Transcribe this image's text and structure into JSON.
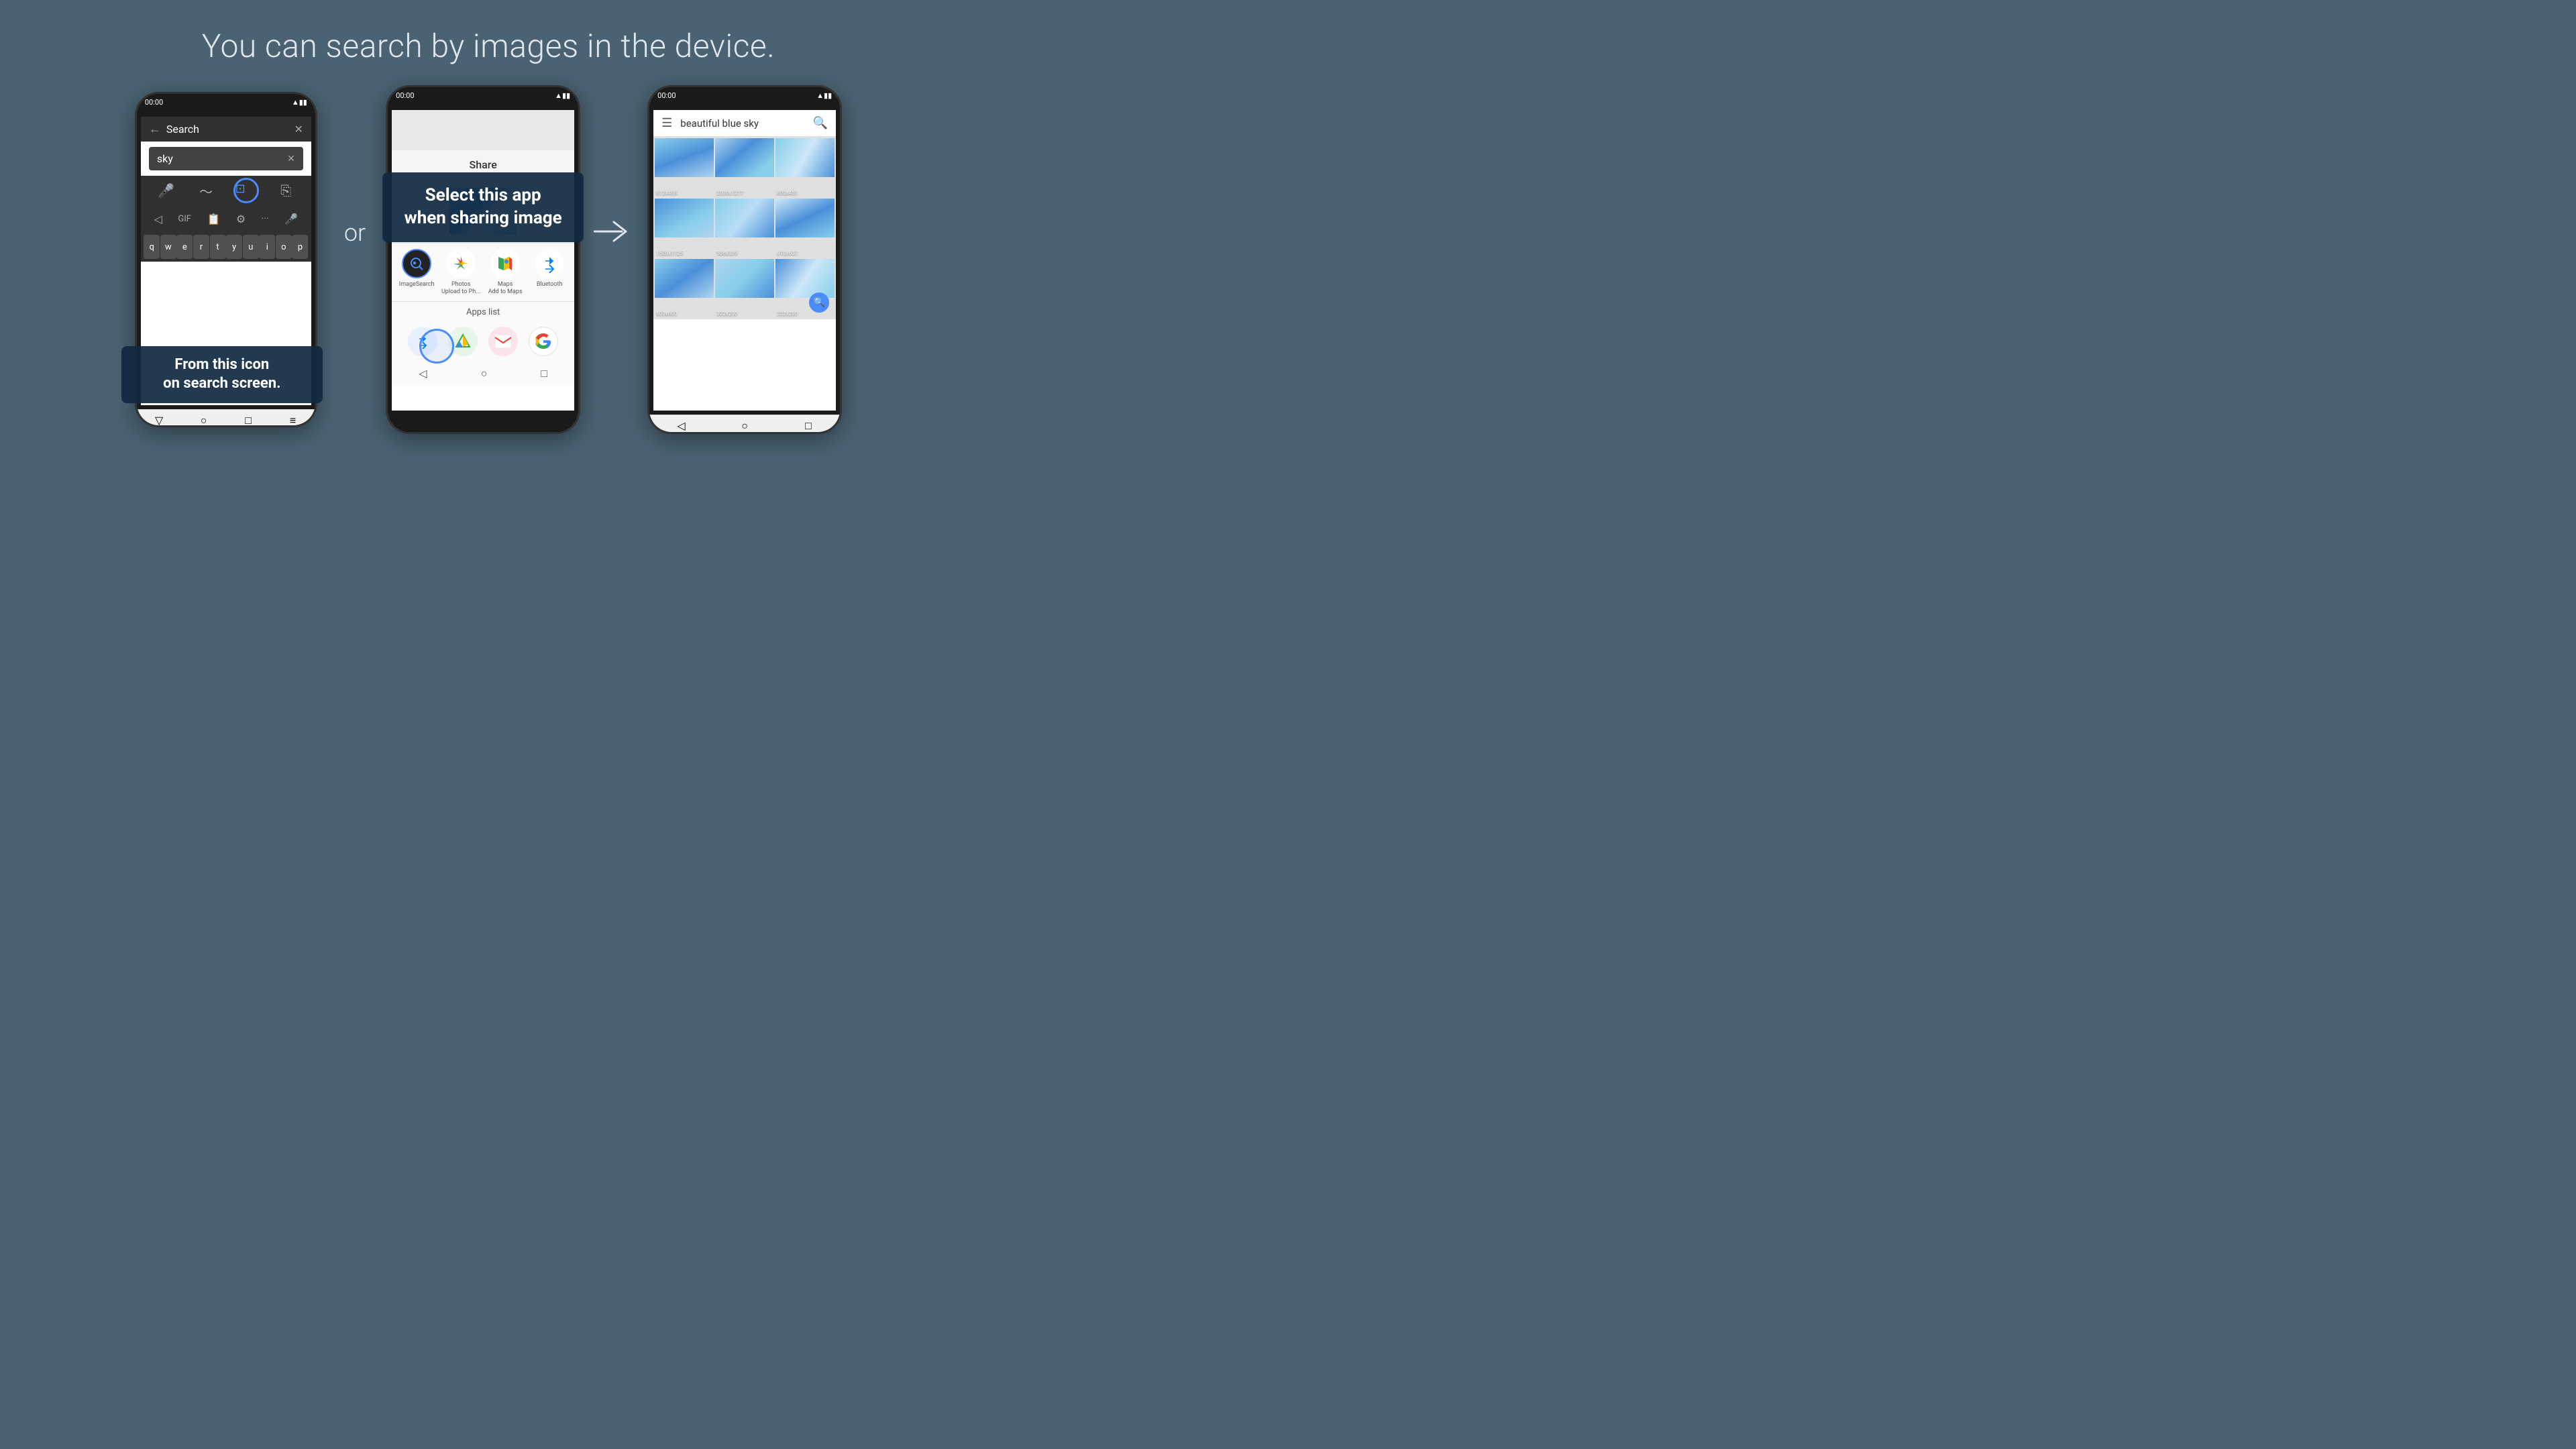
{
  "page": {
    "title": "You can search by images in the device.",
    "background_color": "#4a6272"
  },
  "connector_text": "or",
  "arrow_symbol": "⇒",
  "phone1": {
    "status_time": "00:00",
    "search_placeholder": "Search",
    "search_query": "sky",
    "callout_line1": "From this icon",
    "callout_line2": "on search screen.",
    "keyboard_keys": [
      "q",
      "w",
      "e",
      "r",
      "t",
      "y",
      "u",
      "i",
      "o",
      "p"
    ]
  },
  "phone2": {
    "status_time": "00:00",
    "share_header": "Share",
    "callout_line1": "Select this app",
    "callout_line2": "when sharing image",
    "app1_label": "ImageSearch",
    "app2_label": "Photos\nUpload to Ph...",
    "app3_label": "Maps\nAdd to Maps",
    "app4_label": "Bluetooth",
    "apps_list_label": "Apps list"
  },
  "phone3": {
    "status_time": "00:00",
    "search_query": "beautiful blue sky",
    "grid_items": [
      {
        "label": "612x408"
      },
      {
        "label": "2000x1217"
      },
      {
        "label": "800x451"
      },
      {
        "label": "1500x1125"
      },
      {
        "label": "508x339"
      },
      {
        "label": "910x607"
      },
      {
        "label": "600x600"
      },
      {
        "label": "322x200"
      },
      {
        "label": "322x200"
      }
    ]
  }
}
